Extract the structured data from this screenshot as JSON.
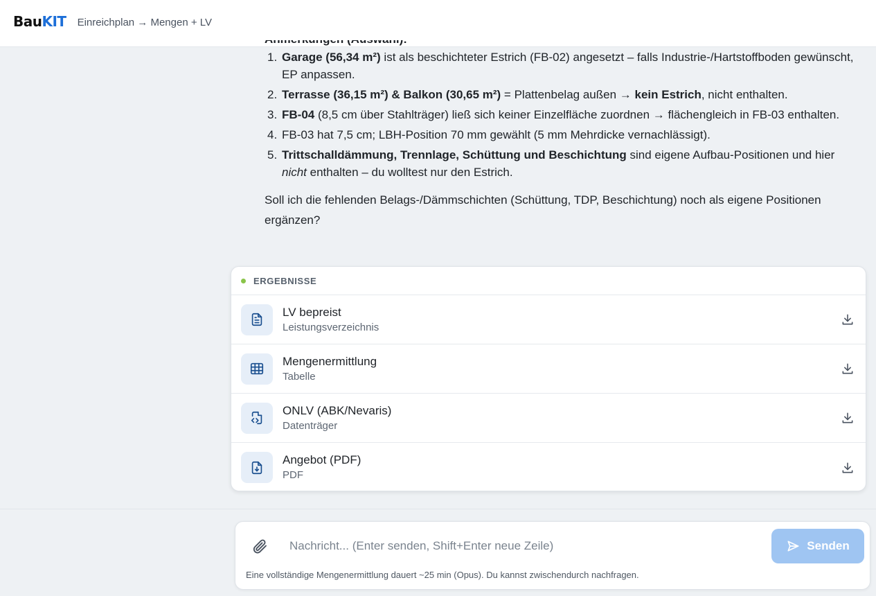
{
  "header": {
    "logo_part1": "Bau",
    "logo_part2": "KIT",
    "breadcrumb": "Einreichplan → Mengen + LV"
  },
  "chat": {
    "partial_heading": "Anmerkungen (Auswahl):",
    "notes": [
      {
        "num": "1.",
        "segments": [
          {
            "text": "Garage (56,34 m²)",
            "style": "bold"
          },
          {
            "text": " ist als beschichteter Estrich (FB-02) angesetzt – falls Industrie-/Hartstoffboden gewünscht, EP anpassen.",
            "style": "normal"
          }
        ]
      },
      {
        "num": "2.",
        "segments": [
          {
            "text": "Terrasse (36,15 m²) & Balkon (30,65 m²)",
            "style": "bold"
          },
          {
            "text": " = Plattenbelag außen → ",
            "style": "normal"
          },
          {
            "text": "kein Estrich",
            "style": "bold"
          },
          {
            "text": ", nicht enthalten.",
            "style": "normal"
          }
        ]
      },
      {
        "num": "3.",
        "segments": [
          {
            "text": "FB-04",
            "style": "bold"
          },
          {
            "text": " (8,5 cm über Stahlträger) ließ sich keiner Einzelfläche zuordnen → flächengleich in FB-03 enthalten.",
            "style": "normal"
          }
        ]
      },
      {
        "num": "4.",
        "segments": [
          {
            "text": "FB-03 hat 7,5 cm; LBH-Position 70 mm gewählt (5 mm Mehrdicke vernachlässigt).",
            "style": "normal"
          }
        ]
      },
      {
        "num": "5.",
        "segments": [
          {
            "text": "Trittschalldämmung, Trennlage, Schüttung und Beschichtung",
            "style": "bold"
          },
          {
            "text": " sind eigene Aufbau-Positionen und hier ",
            "style": "normal"
          },
          {
            "text": "nicht",
            "style": "italic"
          },
          {
            "text": " enthalten – du wolltest nur den Estrich.",
            "style": "normal"
          }
        ]
      }
    ],
    "followup": "Soll ich die fehlenden Belags-/Dämmschichten (Schüttung, TDP, Beschichtung) noch als eigene Positionen ergänzen?"
  },
  "results": {
    "heading": "ERGEBNISSE",
    "status_color": "#8ac44a",
    "items": [
      {
        "title": "LV bepreist",
        "subtitle": "Leistungsverzeichnis",
        "icon": "document-text-icon"
      },
      {
        "title": "Mengenermittlung",
        "subtitle": "Tabelle",
        "icon": "table-icon"
      },
      {
        "title": "ONLV (ABK/Nevaris)",
        "subtitle": "Datenträger",
        "icon": "code-file-icon"
      },
      {
        "title": "Angebot (PDF)",
        "subtitle": "PDF",
        "icon": "file-download-icon"
      }
    ]
  },
  "composer": {
    "value": "",
    "placeholder": "Nachricht... (Enter senden, Shift+Enter neue Zeile)",
    "send_label": "Senden",
    "hint": "Eine vollständige Mengenermittlung dauert ~25 min (Opus). Du kannst zwischendurch nachfragen.",
    "accent_color": "#9fc5f2"
  }
}
